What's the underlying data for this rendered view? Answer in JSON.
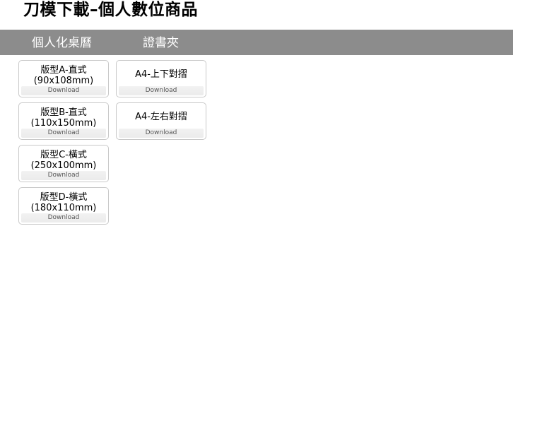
{
  "header": {
    "title": "刀模下載–個人數位商品"
  },
  "categories": [
    {
      "label": "個人化桌曆"
    },
    {
      "label": "證書夾"
    }
  ],
  "download_label": "Download",
  "calendar_items": [
    {
      "title": "版型A-直式",
      "size": "(90x108mm)"
    },
    {
      "title": "版型B-直式",
      "size": "(110x150mm)"
    },
    {
      "title": "版型C-橫式",
      "size": "(250x100mm)"
    },
    {
      "title": "版型D-橫式",
      "size": "(180x110mm)"
    }
  ],
  "certificate_items": [
    {
      "title": "A4-上下對摺"
    },
    {
      "title": "A4-左右對摺"
    }
  ]
}
